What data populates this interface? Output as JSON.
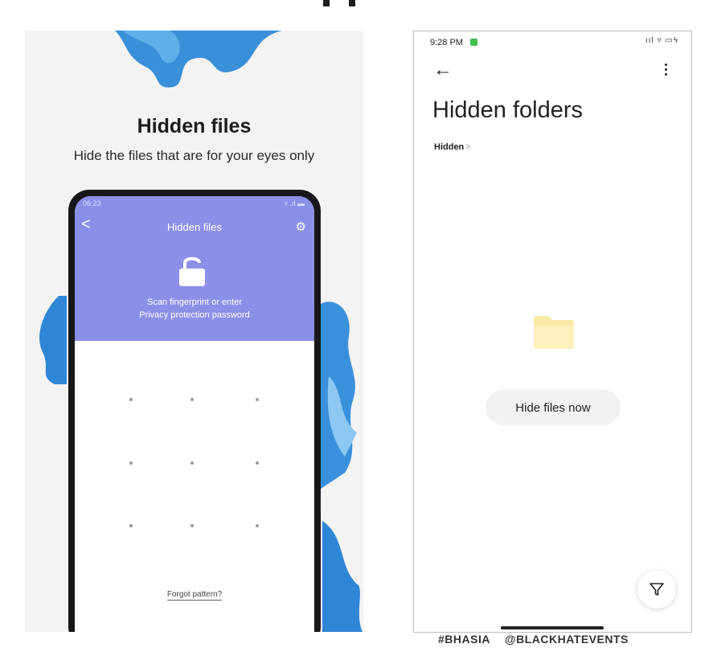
{
  "promo": {
    "title": "Hidden files",
    "subtitle": "Hide the files that are for your eyes only",
    "phone": {
      "status_time": "06:23",
      "status_icons": "▿ .ıl ▬",
      "back_glyph": "<",
      "title": "Hidden files",
      "gear_glyph": "⚙",
      "scan_line1": "Scan fingerprint or enter",
      "scan_line2": "Privacy protection password",
      "forgot_label": "Forgot pattern?",
      "accent_color": "#8a8fe8",
      "pattern_grid": "3x3",
      "lock_icon": "lock-icon"
    }
  },
  "screenshot": {
    "status_time": "9:28 PM",
    "status_right": "ııl ▿ ▭ϟ",
    "back_glyph": "←",
    "more_icon": "vertical-dots-icon",
    "title": "Hidden folders",
    "breadcrumb": {
      "label": "Hidden",
      "separator": ">"
    },
    "empty_icon": "folder-icon",
    "hide_button_label": "Hide files now",
    "fab_icon": "filter-icon"
  },
  "footer": {
    "hashtag": "#BHASIA",
    "handle": "@BLACKHATEVENTS"
  }
}
